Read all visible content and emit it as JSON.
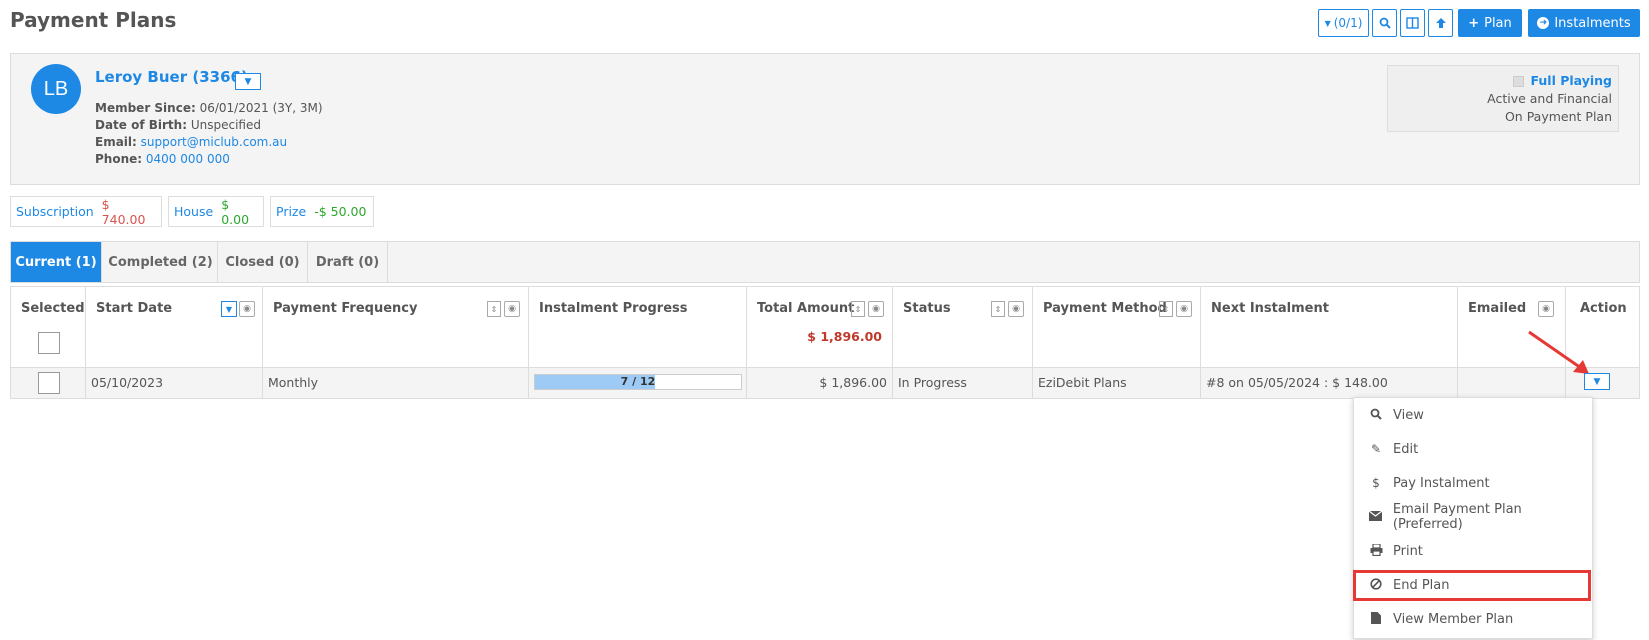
{
  "page": {
    "title": "Payment Plans"
  },
  "toolbar": {
    "filter_label": "(0/1)",
    "plan_label": "Plan",
    "instalments_label": "Instalments"
  },
  "member": {
    "initials": "LB",
    "name": "Leroy Buer (3366)",
    "member_since_label": "Member Since:",
    "member_since": "06/01/2021 (3Y, 3M)",
    "dob_label": "Date of Birth:",
    "dob": "Unspecified",
    "email_label": "Email:",
    "email": "support@miclub.com.au",
    "phone_label": "Phone:",
    "phone": "0400 000 000",
    "status_title": "Full Playing",
    "status_line1": "Active and Financial",
    "status_line2": "On Payment Plan"
  },
  "balances": [
    {
      "label": "Subscription",
      "value": "$ 740.00",
      "color": "#d9534f"
    },
    {
      "label": "House",
      "value": "$ 0.00",
      "color": "#2ea82e"
    },
    {
      "label": "Prize",
      "value": "-$ 50.00",
      "color": "#2ea82e"
    }
  ],
  "tabs": [
    {
      "label": "Current (1)",
      "active": true
    },
    {
      "label": "Completed (2)",
      "active": false
    },
    {
      "label": "Closed (0)",
      "active": false
    },
    {
      "label": "Draft (0)",
      "active": false
    }
  ],
  "table": {
    "headers": {
      "selected": "Selected",
      "start_date": "Start Date",
      "payment_frequency": "Payment Frequency",
      "instalment_progress": "Instalment Progress",
      "total_amount": "Total Amount",
      "status": "Status",
      "payment_method": "Payment Method",
      "next_instalment": "Next Instalment",
      "emailed": "Emailed",
      "action": "Action"
    },
    "total_sum": "$ 1,896.00",
    "row": {
      "start_date": "05/10/2023",
      "payment_frequency": "Monthly",
      "progress_text": "7 / 12",
      "progress_fraction": 0.583,
      "total_amount": "$ 1,896.00",
      "status": "In Progress",
      "payment_method": "EziDebit Plans",
      "next_instalment": "#8 on 05/05/2024 : $ 148.00"
    }
  },
  "action_menu": {
    "items": [
      {
        "label": "View",
        "icon": "search-icon"
      },
      {
        "label": "Edit",
        "icon": "pencil-icon"
      },
      {
        "label": "Pay Instalment",
        "icon": "dollar-icon"
      },
      {
        "label": "Email Payment Plan (Preferred)",
        "icon": "envelope-icon"
      },
      {
        "label": "Print",
        "icon": "print-icon"
      },
      {
        "label": "End Plan",
        "icon": "ban-icon"
      },
      {
        "label": "View Member Plan",
        "icon": "file-icon"
      }
    ]
  },
  "colors": {
    "accent": "#1e88e5",
    "highlight": "#e53935"
  }
}
